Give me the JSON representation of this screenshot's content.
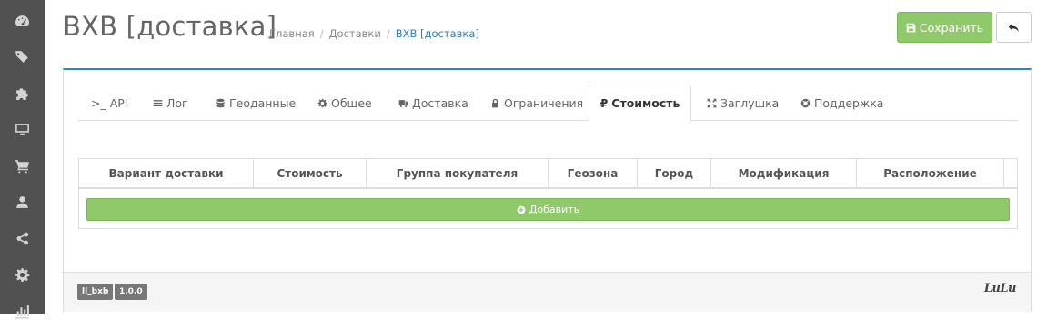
{
  "header": {
    "title": "BXB [доставка]",
    "breadcrumb": [
      "Главная",
      "Доставки",
      "BXB [доставка]"
    ],
    "save_label": "Сохранить"
  },
  "sidebar": {
    "items": [
      "dashboard-icon",
      "tags-icon",
      "puzzle-icon",
      "desktop-icon",
      "cart-icon",
      "user-icon",
      "share-icon",
      "gear-icon",
      "chart-icon"
    ]
  },
  "tabs": [
    {
      "label": ">_ API",
      "icon": "terminal-icon"
    },
    {
      "label": "Лог",
      "icon": "list-icon"
    },
    {
      "label": "Геоданные",
      "icon": "database-icon"
    },
    {
      "label": "Общее",
      "icon": "gear-icon"
    },
    {
      "label": "Доставка",
      "icon": "truck-icon"
    },
    {
      "label": "Ограничения",
      "icon": "lock-icon"
    },
    {
      "label": "Стоимость",
      "icon": "ruble-icon",
      "active": true
    },
    {
      "label": "Заглушка",
      "icon": "expand-icon"
    },
    {
      "label": "Поддержка",
      "icon": "lifebuoy-icon"
    }
  ],
  "table": {
    "columns": [
      "Вариант доставки",
      "Стоимость",
      "Группа покупателя",
      "Геозона",
      "Город",
      "Модификация",
      "Расположение"
    ],
    "add_label": "Добавить"
  },
  "footer": {
    "module_badge": "ll_bxb",
    "version_badge": "1.0.0",
    "logo_text": "LuLu"
  },
  "colors": {
    "accent": "#2e86c1",
    "success": "#8fc96a",
    "sidebar": "#515151"
  }
}
